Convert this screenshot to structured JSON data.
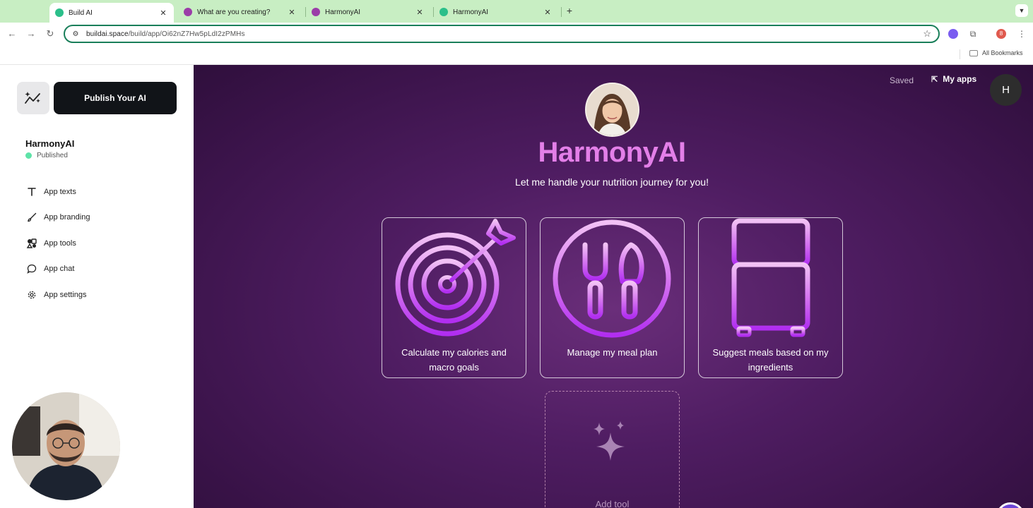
{
  "browser": {
    "tabs": [
      {
        "title": "Build AI",
        "active": true,
        "favicon_color": "#2bbf8a"
      },
      {
        "title": "What are you creating?",
        "active": false,
        "favicon_color": "#9b3da8"
      },
      {
        "title": "HarmonyAI",
        "active": false,
        "favicon_color": "#9b3da8"
      },
      {
        "title": "HarmonyAI",
        "active": false,
        "favicon_color": "#2bbf8a"
      }
    ],
    "url_host": "buildai.space",
    "url_path": "/build/app/Oi62nZ7Hw5pLdI2zPMHs",
    "profile_initial": "8",
    "bookmarks_label": "All Bookmarks"
  },
  "sidebar": {
    "publish_label": "Publish Your AI",
    "app_name": "HarmonyAI",
    "status": "Published",
    "status_color": "#5ee3a8",
    "items": [
      {
        "label": "App texts",
        "icon": "text-icon"
      },
      {
        "label": "App branding",
        "icon": "brush-icon"
      },
      {
        "label": "App tools",
        "icon": "shapes-icon"
      },
      {
        "label": "App chat",
        "icon": "chat-icon"
      },
      {
        "label": "App settings",
        "icon": "gear-icon"
      }
    ]
  },
  "main": {
    "saved_label": "Saved",
    "my_apps_label": "My apps",
    "user_initial": "H",
    "title": "HarmonyAI",
    "subtitle": "Let me handle your nutrition journey for you!",
    "accent_color": "#e37fe8",
    "tools": [
      {
        "label": "Calculate my calories and macro goals",
        "icon": "target-arrow-icon"
      },
      {
        "label": "Manage my meal plan",
        "icon": "fork-knife-icon"
      },
      {
        "label": "Suggest meals based on my ingredients",
        "icon": "fridge-icon"
      }
    ],
    "add_tool_label": "Add tool"
  }
}
